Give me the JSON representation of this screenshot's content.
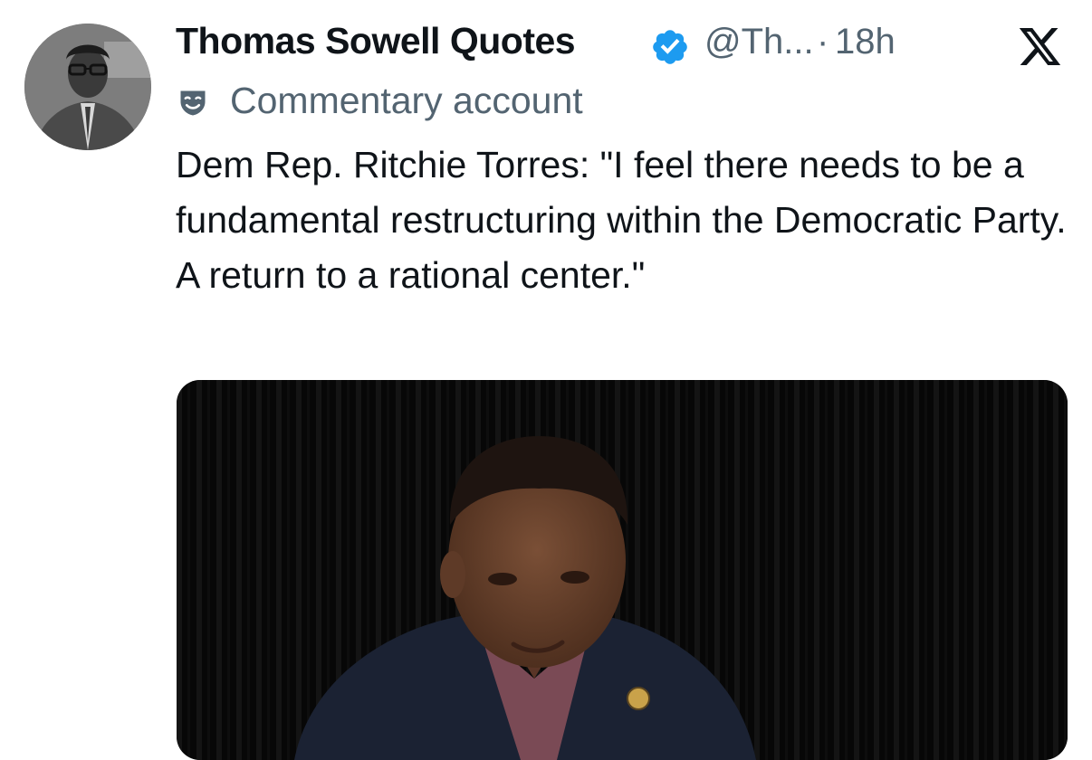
{
  "tweet": {
    "author_name": "Thomas Sowell Quotes",
    "handle": "@Th...",
    "separator": "·",
    "time": "18h",
    "label": "Commentary account",
    "text": "Dem Rep. Ritchie Torres: \"I feel there needs to be a fundamental restructuring within the Democratic Party. A return to a rational center.\""
  },
  "colors": {
    "verified": "#1d9bf0",
    "secondary_text": "#536471",
    "primary_text": "#0f1419"
  },
  "icons": {
    "verified": "verified-badge-icon",
    "label": "theater-mask-icon",
    "brand": "x-logo-icon"
  }
}
